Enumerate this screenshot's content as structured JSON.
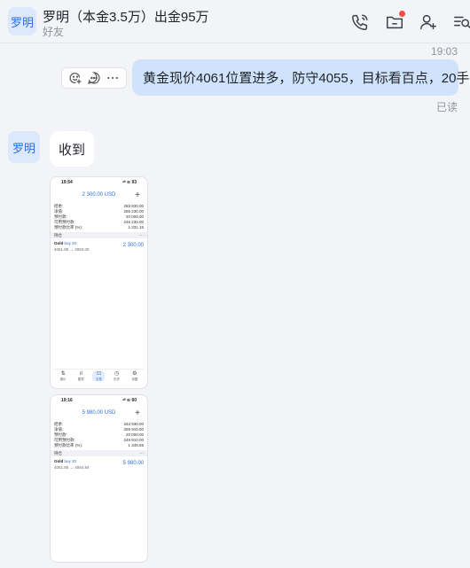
{
  "header": {
    "avatar_text": "罗明",
    "title": "罗明（本金3.5万）出金95万",
    "subtitle": "好友"
  },
  "messages": {
    "timestamp": "19:03",
    "outgoing_text": "黄金现价4061位置进多，防守4055，目标看百点，20手",
    "read_status": "已读",
    "incoming_avatar_text": "罗明",
    "incoming_text": "收到"
  },
  "shots": [
    {
      "time": "19:54",
      "status_icons": "ᵃˡˡ ≋ 93",
      "total": "2 300.00 USD",
      "plus": "+",
      "rows": [
        {
          "label": "结余:",
          "value": "283 930.00"
        },
        {
          "label": "净值:",
          "value": "286 230.00"
        },
        {
          "label": "预付款:",
          "value": "20 000.00"
        },
        {
          "label": "可用预付款:",
          "value": "246 230.00"
        },
        {
          "label": "预付款比率 (%):",
          "value": "1 331.15"
        }
      ],
      "section_label": "持仓",
      "section_dots": "···",
      "position": {
        "name": "Gold",
        "dir": "buy 20",
        "prices": "4061.85 → 4063.00",
        "pnl": "2 300.00"
      },
      "nav": [
        {
          "icon": "⇅",
          "label": "报价"
        },
        {
          "icon": "ıl",
          "label": "图表"
        },
        {
          "icon": "⊡",
          "label": "交易"
        },
        {
          "icon": "◷",
          "label": "历史"
        },
        {
          "icon": "⚙",
          "label": "设置"
        }
      ]
    },
    {
      "time": "19:16",
      "status_icons": "ᵃˡˡ ≋ 60",
      "total": "5 980.00 USD",
      "plus": "+",
      "rows": [
        {
          "label": "结余:",
          "value": "263 930.00"
        },
        {
          "label": "净值:",
          "value": "269 910.00"
        },
        {
          "label": "预付款:",
          "value": "20 000.00"
        },
        {
          "label": "可用预付款:",
          "value": "249 910.00"
        },
        {
          "label": "预付款比率 (%):",
          "value": "1 349.55"
        }
      ],
      "section_label": "持仓",
      "section_dots": "···",
      "position": {
        "name": "Gold",
        "dir": "buy 20",
        "prices": "4061.85 → 4064.84",
        "pnl": "5 980.00"
      }
    }
  ]
}
